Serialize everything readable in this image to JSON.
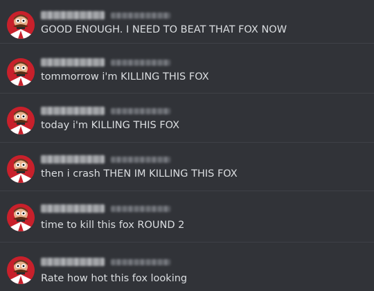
{
  "messages": [
    {
      "text": "GOOD ENOUGH. I NEED TO BEAT THAT FOX NOW"
    },
    {
      "text": "tommorrow i'm KILLING THIS FOX"
    },
    {
      "text": "today i'm KILLING THIS FOX"
    },
    {
      "text": "then i crash THEN IM KILLING THIS FOX"
    },
    {
      "text": "time to kill this fox ROUND 2"
    },
    {
      "text": "Rate how hot this fox looking"
    }
  ],
  "colors": {
    "background": "#313338",
    "divider": "#3f4147",
    "message_text": "#dbdee1",
    "avatar_red": "#c8202b"
  },
  "icons": {
    "avatar": "robotnik-avatar-icon"
  }
}
